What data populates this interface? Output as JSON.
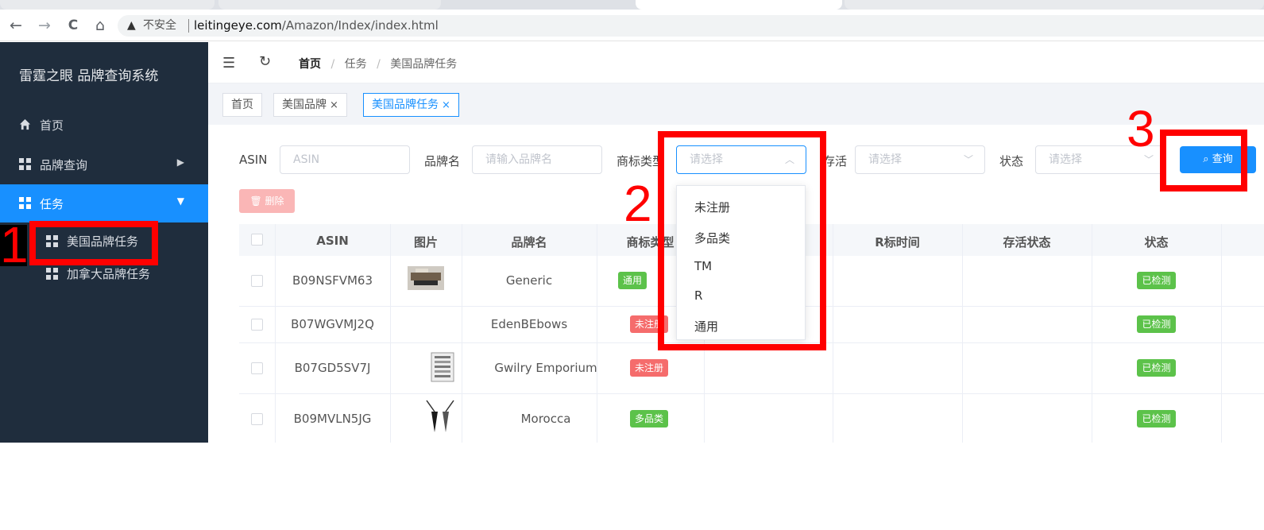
{
  "browser": {
    "nav": {
      "back": "←",
      "forward": "→",
      "reload": "C",
      "home": "⌂"
    },
    "security_warning": "▲",
    "security_text": "不安全",
    "url_host": "leitingeye.com",
    "url_path": "/Amazon/Index/index.html"
  },
  "sidebar": {
    "brand": "雷霆之眼 品牌查询系统",
    "items": [
      {
        "label": "首页",
        "icon": "home-icon"
      },
      {
        "label": "品牌查询",
        "icon": "grid-icon",
        "arrow": "▶"
      },
      {
        "label": "任务",
        "icon": "grid-icon",
        "arrow": "▼",
        "active": true
      }
    ],
    "subitems": [
      {
        "label": "美国品牌任务"
      },
      {
        "label": "加拿大品牌任务"
      }
    ],
    "active_color": "#1890ff"
  },
  "header": {
    "breadcrumb": [
      "首页",
      "任务",
      "美国品牌任务"
    ],
    "separator": "/"
  },
  "tags": [
    {
      "label": "首页"
    },
    {
      "label": "美国品牌",
      "close": "×"
    },
    {
      "label": "美国品牌任务",
      "close": "×",
      "active": true
    }
  ],
  "filters": {
    "asin_label": "ASIN",
    "asin_placeholder": "ASIN",
    "brand_label": "品牌名",
    "brand_placeholder": "请输入品牌名",
    "type_label": "商标类型",
    "type_placeholder": "请选择",
    "alive_label": "存活",
    "alive_placeholder": "请选择",
    "status_label": "状态",
    "status_placeholder": "请选择",
    "query_button": "查询",
    "delete_button": "删除"
  },
  "dropdown": {
    "options": [
      "未注册",
      "多品类",
      "TM",
      "R",
      "通用"
    ]
  },
  "table": {
    "columns": [
      "ASIN",
      "图片",
      "品牌名",
      "商标类型",
      "R标时间",
      "存活状态",
      "状态"
    ],
    "rows": [
      {
        "asin": "B09NSFVM63",
        "brand": "Generic",
        "type": "通用",
        "type_color": "#5cc24a",
        "status": "已检测"
      },
      {
        "asin": "B07WGVMJ2Q",
        "brand": "EdenBEbows",
        "type": "未注册",
        "type_color": "#f56c6c",
        "status": "已检测"
      },
      {
        "asin": "B07GD5SV7J",
        "brand": "Gwilry Emporium",
        "type": "未注册",
        "type_color": "#f56c6c",
        "status": "已检测"
      },
      {
        "asin": "B09MVLN5JG",
        "brand": "Morocca",
        "type": "多品类",
        "type_color": "#5cc24a",
        "status": "已检测"
      }
    ]
  },
  "annotations": {
    "labels": [
      "1",
      "2",
      "3"
    ],
    "color": "#ff0000"
  }
}
